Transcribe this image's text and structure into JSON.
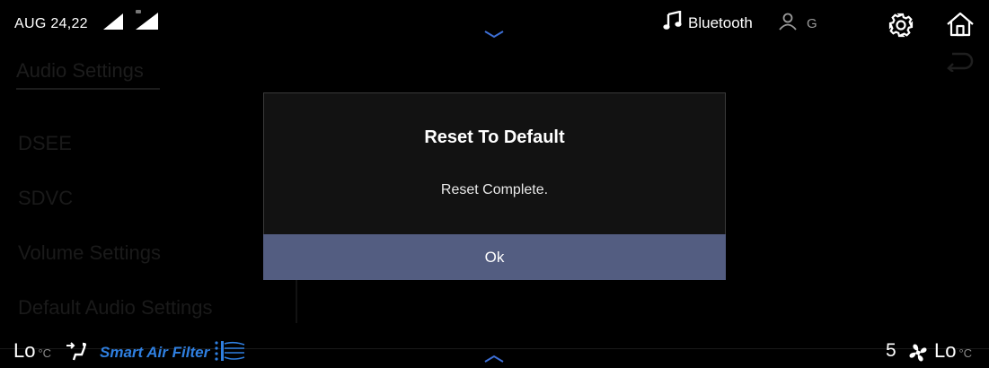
{
  "status_bar": {
    "date": "AUG 24,22",
    "media_source": "Bluetooth",
    "user_initial": "G",
    "icons": [
      "signal-strength-icon",
      "signal-strength-icon",
      "chevron-down-icon",
      "music-note-icon",
      "user-icon",
      "gear-icon",
      "home-icon"
    ]
  },
  "background_menu": {
    "title": "Audio Settings",
    "items": [
      "DSEE",
      "SDVC",
      "Volume Settings",
      "Default Audio Settings"
    ],
    "back_icon": "back-arrow-icon"
  },
  "dialog": {
    "title": "Reset To Default",
    "message": "Reset Complete.",
    "ok_label": "Ok",
    "ok_color": "#535d81"
  },
  "climate_bar": {
    "left_temp": "Lo",
    "left_unit": "°C",
    "smart_air_label": "Smart Air Filter",
    "smart_air_color": "#2f7fe0",
    "fan_speed": "5",
    "right_temp": "Lo",
    "right_unit": "°C",
    "icons": [
      "seat-airflow-icon",
      "air-filter-icon",
      "chevron-up-icon",
      "fan-icon"
    ]
  }
}
